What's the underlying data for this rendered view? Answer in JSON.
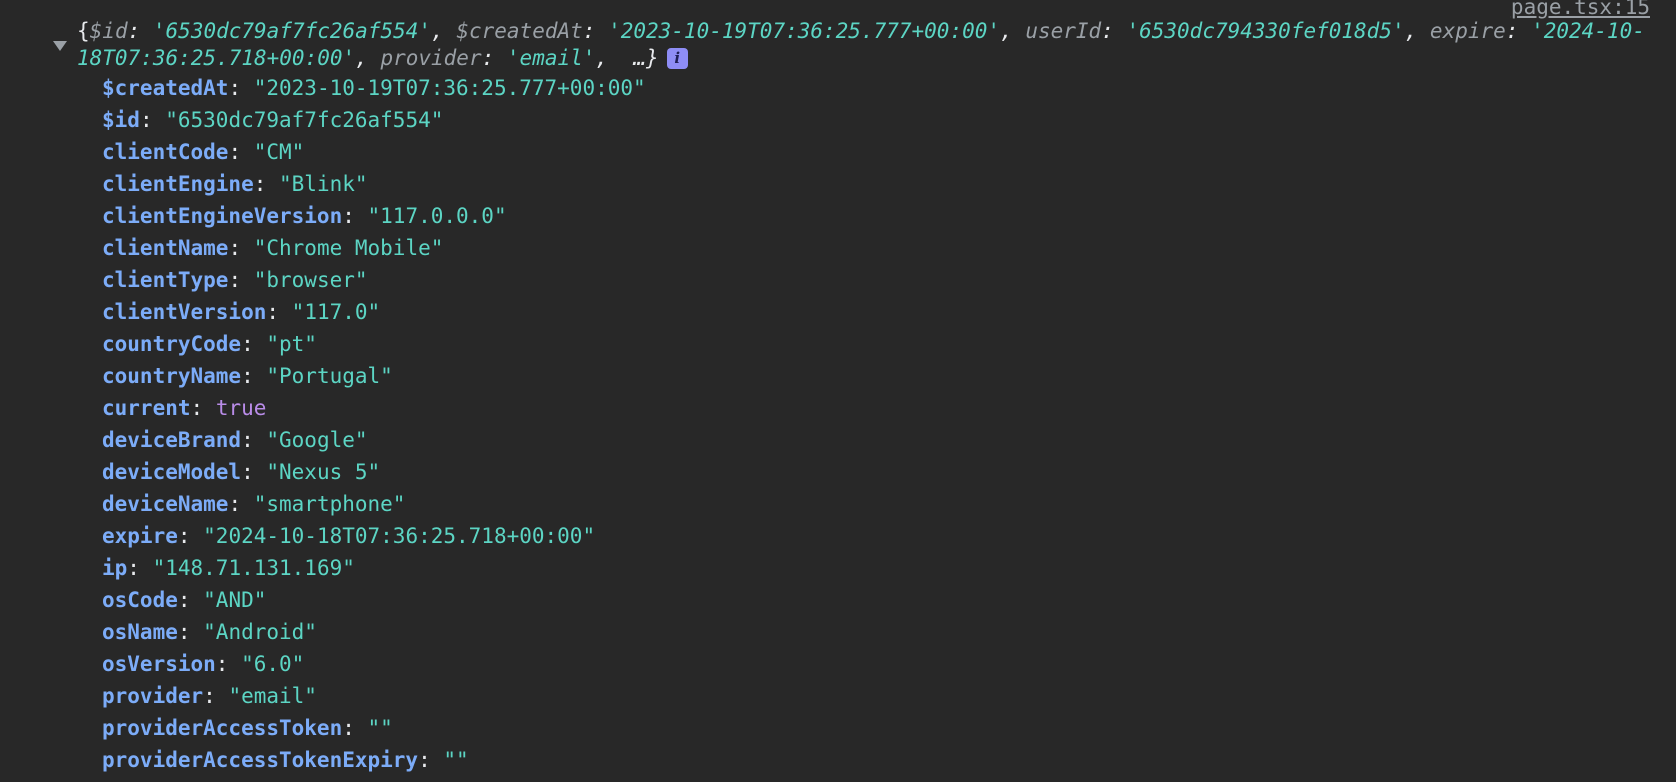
{
  "source": {
    "label": "page.tsx:15"
  },
  "summary": {
    "open": "{",
    "entries": [
      {
        "key": "$id",
        "value": "'6530dc79af7fc26af554'"
      },
      {
        "key": "$createdAt",
        "value": "'2023-10-19T07:36:25.777+00:00'"
      },
      {
        "key": "userId",
        "value": "'6530dc794330fef018d5'"
      },
      {
        "key": "expire",
        "value": "'2024-10-18T07:36:25.718+00:00'"
      },
      {
        "key": "provider",
        "value": "'email'"
      }
    ],
    "ellipsis": "…}",
    "info_badge": "i"
  },
  "properties": [
    {
      "key": "$createdAt",
      "value": "\"2023-10-19T07:36:25.777+00:00\"",
      "type": "string"
    },
    {
      "key": "$id",
      "value": "\"6530dc79af7fc26af554\"",
      "type": "string"
    },
    {
      "key": "clientCode",
      "value": "\"CM\"",
      "type": "string"
    },
    {
      "key": "clientEngine",
      "value": "\"Blink\"",
      "type": "string"
    },
    {
      "key": "clientEngineVersion",
      "value": "\"117.0.0.0\"",
      "type": "string"
    },
    {
      "key": "clientName",
      "value": "\"Chrome Mobile\"",
      "type": "string"
    },
    {
      "key": "clientType",
      "value": "\"browser\"",
      "type": "string"
    },
    {
      "key": "clientVersion",
      "value": "\"117.0\"",
      "type": "string"
    },
    {
      "key": "countryCode",
      "value": "\"pt\"",
      "type": "string"
    },
    {
      "key": "countryName",
      "value": "\"Portugal\"",
      "type": "string"
    },
    {
      "key": "current",
      "value": "true",
      "type": "boolean"
    },
    {
      "key": "deviceBrand",
      "value": "\"Google\"",
      "type": "string"
    },
    {
      "key": "deviceModel",
      "value": "\"Nexus 5\"",
      "type": "string"
    },
    {
      "key": "deviceName",
      "value": "\"smartphone\"",
      "type": "string"
    },
    {
      "key": "expire",
      "value": "\"2024-10-18T07:36:25.718+00:00\"",
      "type": "string"
    },
    {
      "key": "ip",
      "value": "\"148.71.131.169\"",
      "type": "string"
    },
    {
      "key": "osCode",
      "value": "\"AND\"",
      "type": "string"
    },
    {
      "key": "osName",
      "value": "\"Android\"",
      "type": "string"
    },
    {
      "key": "osVersion",
      "value": "\"6.0\"",
      "type": "string"
    },
    {
      "key": "provider",
      "value": "\"email\"",
      "type": "string"
    },
    {
      "key": "providerAccessToken",
      "value": "\"\"",
      "type": "string"
    },
    {
      "key": "providerAccessTokenExpiry",
      "value": "\"\"",
      "type": "string"
    }
  ],
  "colors": {
    "background": "#282828",
    "key": "#7cacf8",
    "string": "#5cd5c4",
    "boolean": "#b98ce8",
    "preview_key": "#9aa0a6",
    "info_badge": "#8e8df5"
  },
  "icons": {
    "toggle": "triangle-down-icon",
    "info": "info-icon"
  }
}
